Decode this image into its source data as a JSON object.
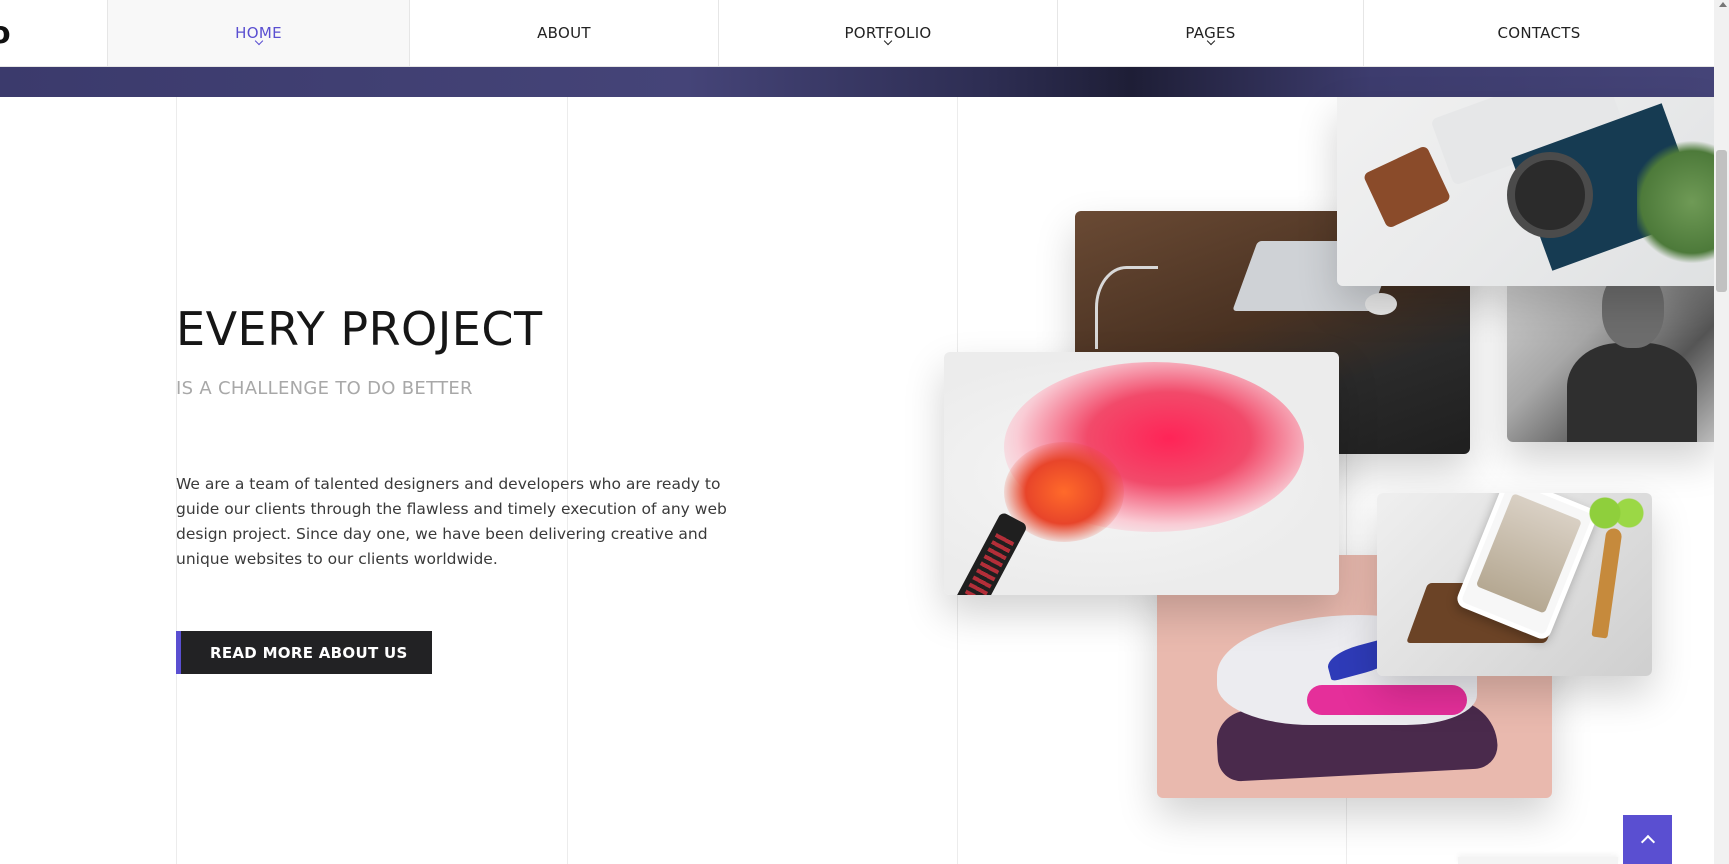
{
  "nav": {
    "logo": "o",
    "items": [
      {
        "label": "HOME",
        "active": true,
        "has_dropdown": true
      },
      {
        "label": "ABOUT",
        "active": false,
        "has_dropdown": false
      },
      {
        "label": "PORTFOLIO",
        "active": false,
        "has_dropdown": true
      },
      {
        "label": "PAGES",
        "active": false,
        "has_dropdown": true
      },
      {
        "label": "CONTACTS",
        "active": false,
        "has_dropdown": false
      }
    ]
  },
  "hero": {
    "title": "EVERY PROJECT",
    "subtitle": "IS A CHALLENGE TO DO BETTER",
    "description": "We are a team of talented designers and developers who are ready to guide our clients through the flawless and timely execution of any web design project. Since day one, we have been delivering creative and unique websites to our clients worldwide.",
    "cta_label": "READ MORE ABOUT US"
  },
  "gallery": [
    {
      "name": "laptop-desk-photo"
    },
    {
      "name": "flatlay-photo"
    },
    {
      "name": "portrait-photo"
    },
    {
      "name": "smoke-flare-photo"
    },
    {
      "name": "sneaker-photo"
    },
    {
      "name": "tablet-kitchen-photo"
    }
  ],
  "icons": {
    "nav_dropdown": "chevron-down-icon",
    "back_to_top": "chevron-up-icon"
  },
  "colors": {
    "accent": "#5a4fd1",
    "banner": "#3f3e70",
    "button_bg": "#222224",
    "subtitle": "#a8a8a8"
  }
}
